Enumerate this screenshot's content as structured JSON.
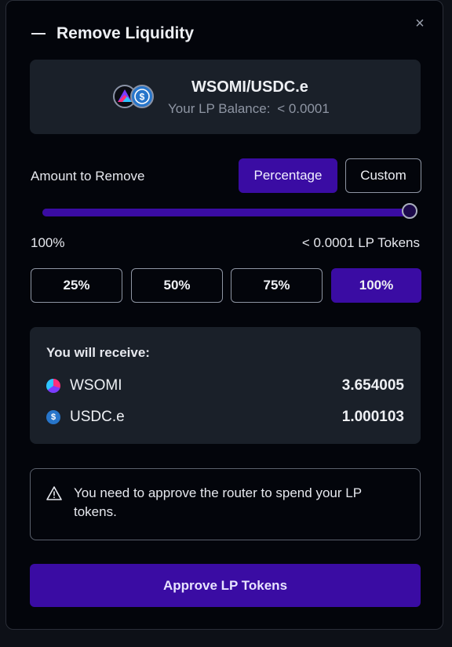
{
  "modal": {
    "title": "Remove Liquidity",
    "close_label": "×"
  },
  "pair": {
    "name": "WSOMI/USDC.e",
    "balance_label": "Your LP Balance:",
    "balance_value": "< 0.0001",
    "icons": [
      "wsomi-icon",
      "usdc-icon"
    ]
  },
  "amount": {
    "label": "Amount to Remove",
    "modes": [
      "Percentage",
      "Custom"
    ],
    "selected_mode": "Percentage",
    "slider_percent": 100,
    "percent_text": "100%",
    "tokens_text": "< 0.0001 LP Tokens",
    "quick_options": [
      "25%",
      "50%",
      "75%",
      "100%"
    ],
    "selected_quick": "100%"
  },
  "receive": {
    "title": "You will receive:",
    "tokens": [
      {
        "symbol": "WSOMI",
        "amount": "3.654005",
        "icon": "wsomi-icon"
      },
      {
        "symbol": "USDC.e",
        "amount": "1.000103",
        "icon": "usdc-icon"
      }
    ]
  },
  "warning": {
    "icon": "warning-triangle-icon",
    "text": "You need to approve the router to spend your LP tokens."
  },
  "actions": {
    "approve_label": "Approve LP Tokens"
  },
  "colors": {
    "accent": "#3a0ca3",
    "card": "#1a2029",
    "modal_bg": "#03050b"
  }
}
